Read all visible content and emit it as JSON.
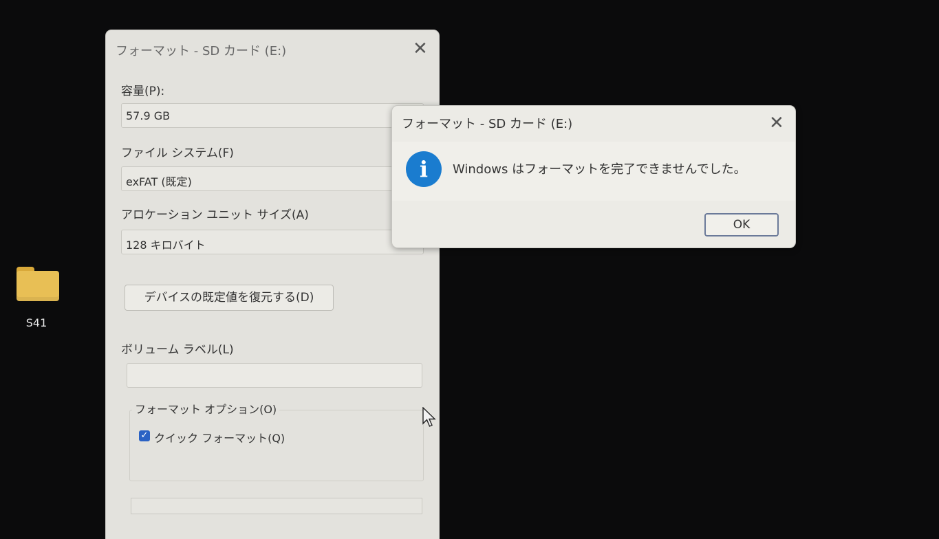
{
  "desktop": {
    "folder_label": "S41"
  },
  "format_window": {
    "title": "フォーマット - SD カード (E:)",
    "capacity_label": "容量(P):",
    "capacity_value": "57.9 GB",
    "filesystem_label": "ファイル システム(F)",
    "filesystem_value": "exFAT (既定)",
    "allocation_label": "アロケーション ユニット サイズ(A)",
    "allocation_value": "128 キロバイト",
    "restore_button": "デバイスの既定値を復元する(D)",
    "volume_label_label": "ボリューム ラベル(L)",
    "volume_label_value": "",
    "options_title": "フォーマット オプション(O)",
    "quick_format_label": "クイック フォーマット(Q)",
    "quick_format_checked": true
  },
  "message_dialog": {
    "title": "フォーマット - SD カード (E:)",
    "message": "Windows はフォーマットを完了できませんでした。",
    "ok_button": "OK"
  },
  "icons": {
    "close": "close-icon",
    "info": "info-icon",
    "folder": "folder-icon",
    "checkbox": "checkbox-checked-icon",
    "cursor": "mouse-cursor-icon"
  },
  "colors": {
    "info_blue": "#1a7ccf",
    "checkbox_blue": "#2b62c4",
    "folder_yellow": "#e8bf55"
  }
}
